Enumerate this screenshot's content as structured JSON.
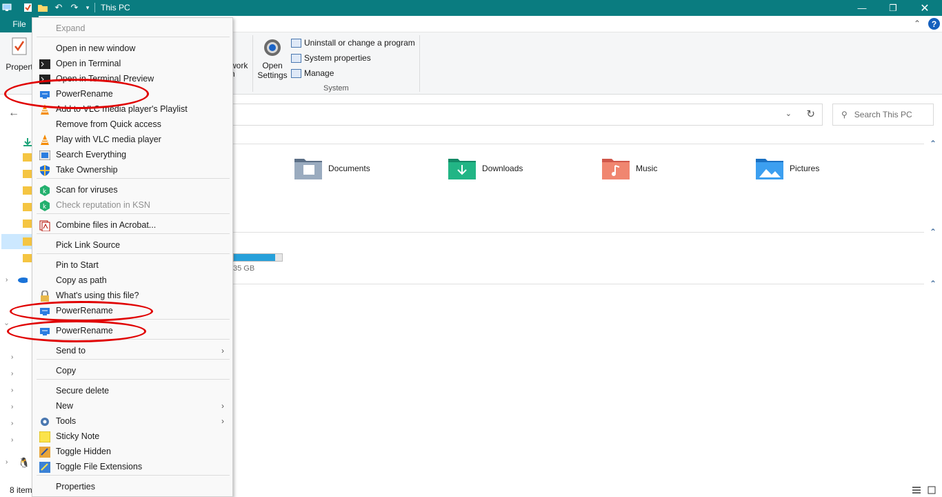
{
  "window": {
    "title": "This PC"
  },
  "tabs": {
    "file": "File"
  },
  "ribbon": {
    "properties": "Propert",
    "network_fragment_1": "work",
    "network_fragment_2": "n",
    "open_settings": [
      "Open",
      "Settings"
    ],
    "uninstall": "Uninstall or change a program",
    "system_properties": "System properties",
    "manage": "Manage",
    "group_system": "System"
  },
  "search": {
    "placeholder": "Search This PC"
  },
  "folders": [
    {
      "name": "Documents",
      "color": "#7b8fa8"
    },
    {
      "name": "Downloads",
      "color": "#1fa47a"
    },
    {
      "name": "Music",
      "color": "#e0685c"
    },
    {
      "name": "Pictures",
      "color": "#2b8fe0"
    }
  ],
  "drive": {
    "size_text": "35 GB",
    "used_fraction": 0.85
  },
  "status": {
    "items": "8 item"
  },
  "context_menu": {
    "items": [
      {
        "label": "Expand",
        "disabled": true,
        "icon": ""
      },
      {
        "label": "Open in new window",
        "icon": ""
      },
      {
        "label": "Open in Terminal",
        "icon": "terminal-icon"
      },
      {
        "label": "Open in Terminal Preview",
        "icon": "terminal-icon"
      },
      {
        "label": "PowerRename",
        "icon": "powerrename-icon"
      },
      {
        "label": "Add to VLC media player's Playlist",
        "icon": "vlc-icon"
      },
      {
        "label": "Remove from Quick access",
        "icon": ""
      },
      {
        "label": "Play with VLC media player",
        "icon": "vlc-icon"
      },
      {
        "label": "Search Everything",
        "icon": "everything-icon"
      },
      {
        "label": "Take Ownership",
        "icon": "shield-icon"
      },
      {
        "label": "Scan for viruses",
        "icon": "kaspersky-icon"
      },
      {
        "label": "Check reputation in KSN",
        "disabled": true,
        "icon": "kaspersky-icon"
      },
      {
        "label": "Combine files in Acrobat...",
        "icon": "acrobat-icon"
      },
      {
        "label": "Pick Link Source",
        "icon": ""
      },
      {
        "label": "Pin to Start",
        "icon": ""
      },
      {
        "label": "Copy as path",
        "icon": ""
      },
      {
        "label": "What's using this file?",
        "icon": "lock-icon"
      },
      {
        "label": "PowerRename",
        "icon": "powerrename-icon"
      },
      {
        "label": "PowerRename",
        "icon": "powerrename-icon"
      },
      {
        "label": "Send to",
        "icon": ""
      },
      {
        "label": "Copy",
        "icon": ""
      },
      {
        "label": "Secure delete",
        "icon": ""
      },
      {
        "label": "New",
        "icon": ""
      },
      {
        "label": "Tools",
        "icon": "tools-icon"
      },
      {
        "label": "Sticky Note",
        "icon": "sticky-note-icon"
      },
      {
        "label": "Toggle Hidden",
        "icon": "toggle-hidden-icon"
      },
      {
        "label": "Toggle File Extensions",
        "icon": "toggle-extensions-icon"
      },
      {
        "label": "Properties",
        "icon": ""
      }
    ]
  },
  "colors": {
    "titlebar": "#0a7c80",
    "annotation": "#e00000",
    "accent": "#26a0da"
  }
}
